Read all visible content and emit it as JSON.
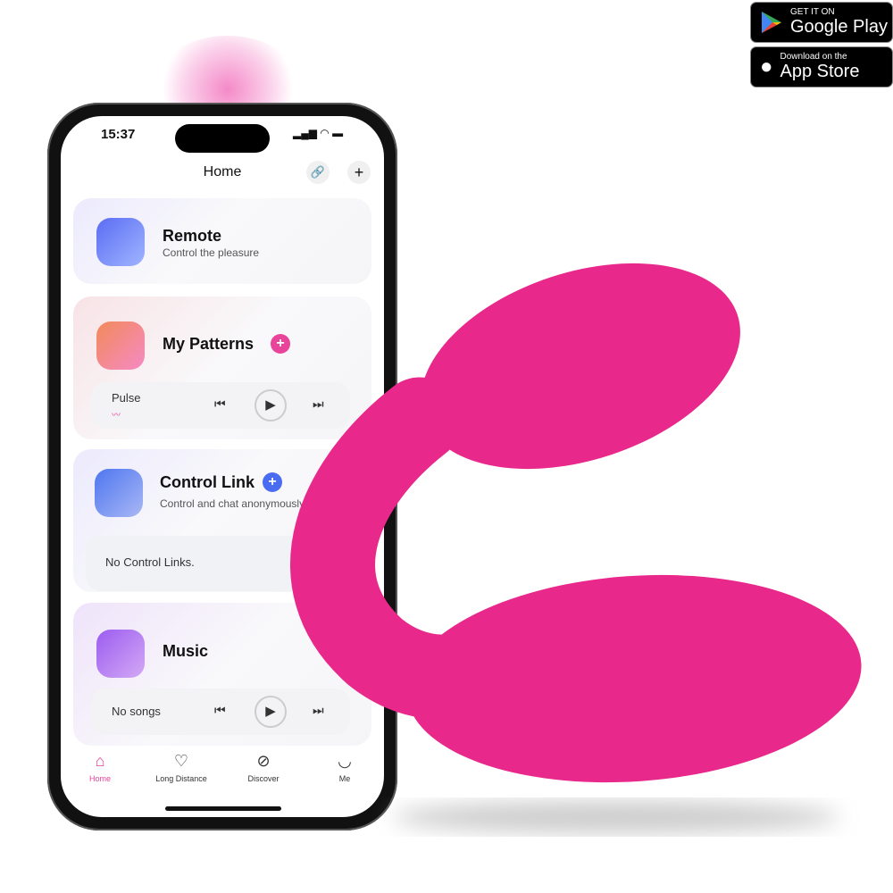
{
  "badges": {
    "google": {
      "small": "GET IT ON",
      "big": "Google Play"
    },
    "apple": {
      "small": "Download on the",
      "big": "App Store"
    }
  },
  "status": {
    "time": "15:37"
  },
  "header": {
    "title": "Home"
  },
  "cards": {
    "remote": {
      "title": "Remote",
      "subtitle": "Control the pleasure"
    },
    "patterns": {
      "title": "My Patterns",
      "current": "Pulse"
    },
    "control_link": {
      "title": "Control Link",
      "subtitle": "Control and chat anonymously",
      "empty": "No Control Links."
    },
    "music": {
      "title": "Music",
      "empty": "No songs"
    }
  },
  "tabs": [
    {
      "label": "Home",
      "active": true
    },
    {
      "label": "Long Distance"
    },
    {
      "label": "Discover"
    },
    {
      "label": "Me"
    }
  ],
  "colors": {
    "accent": "#e8449a",
    "product": "#e8288a",
    "link_blue": "#4a6cf0"
  }
}
